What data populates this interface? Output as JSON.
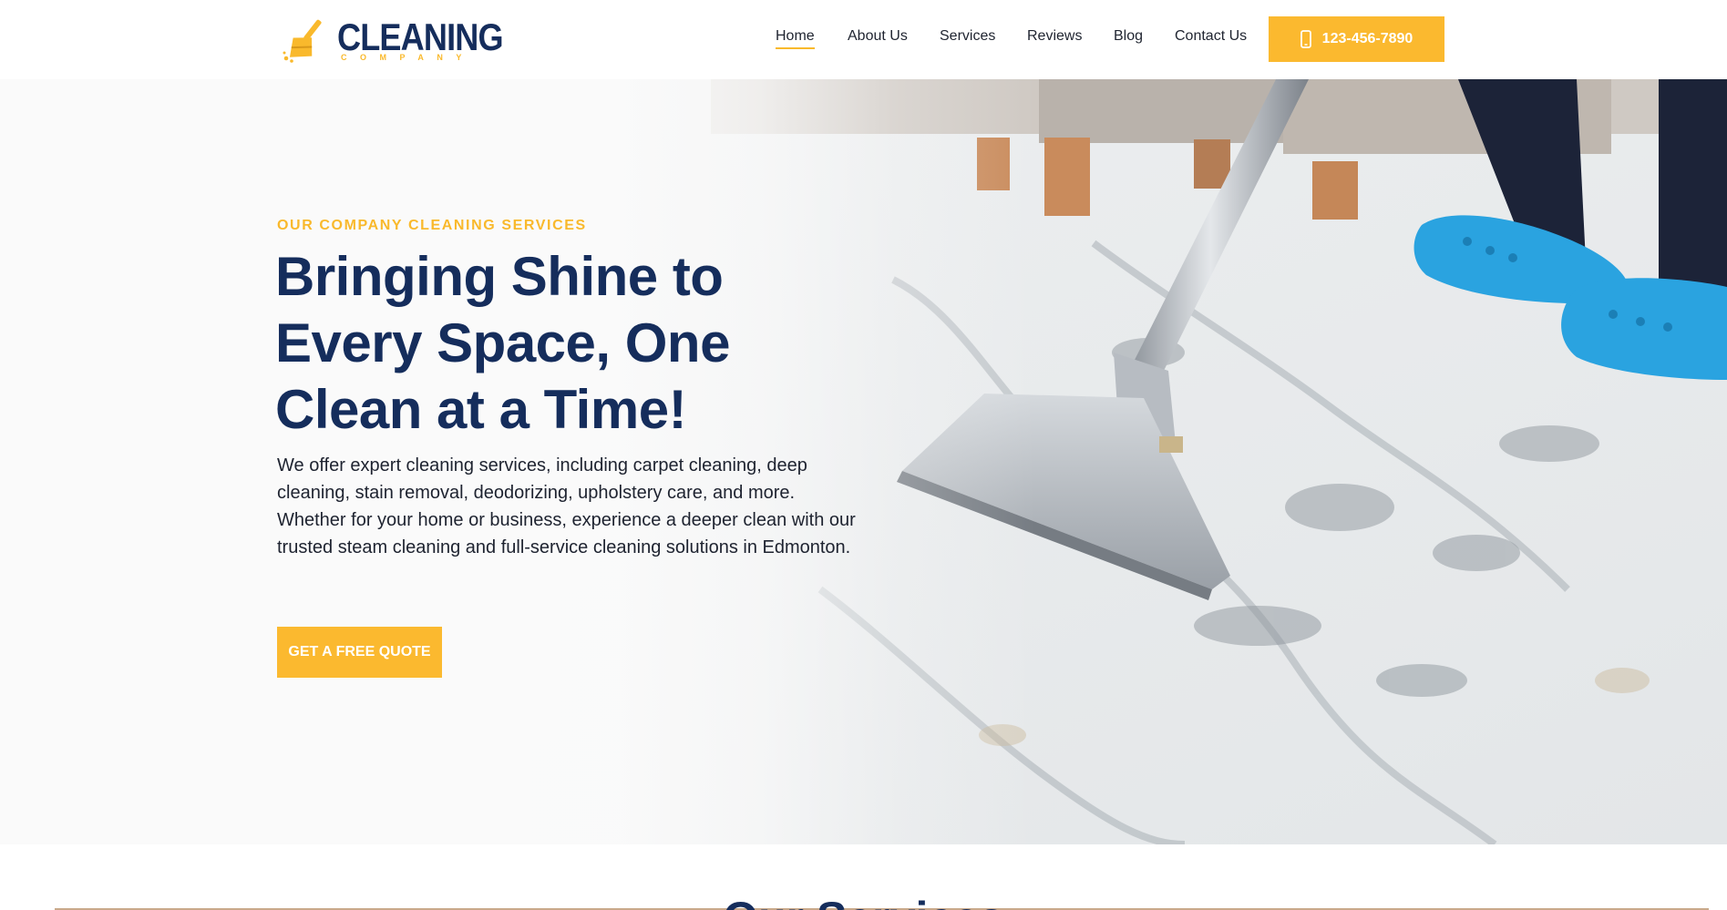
{
  "brand": {
    "name": "CLEANING",
    "tagline": "COMPANY",
    "colors": {
      "navy": "#152d5c",
      "accent": "#f9b92c",
      "text": "#1f2430"
    }
  },
  "nav": {
    "items": [
      {
        "label": "Home",
        "active": true
      },
      {
        "label": "About Us",
        "active": false
      },
      {
        "label": "Services",
        "active": false
      },
      {
        "label": "Reviews",
        "active": false
      },
      {
        "label": "Blog",
        "active": false
      },
      {
        "label": "Contact Us",
        "active": false
      }
    ],
    "phone": {
      "icon": "mobile-phone-icon",
      "label": "123-456-7890"
    }
  },
  "hero": {
    "kicker": "OUR COMPANY CLEANING SERVICES",
    "headline": "Bringing Shine to Every Space, One Clean at a Time!",
    "description": "We offer expert cleaning services, including carpet cleaning, deep cleaning, stain removal, deodorizing, upholstery care, and more. Whether for your home or business, experience a deeper clean with our trusted steam cleaning and full-service cleaning solutions in Edmonton.",
    "cta": "GET A FREE QUOTE"
  },
  "services": {
    "title": "Our Services"
  }
}
